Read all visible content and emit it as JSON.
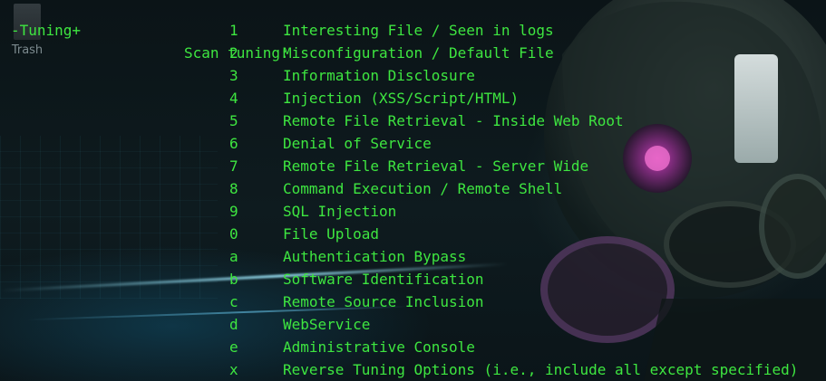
{
  "desktop": {
    "trash_label": "Trash"
  },
  "terminal": {
    "option_name": "-Tuning+",
    "option_description": "Scan tuning:",
    "tuning_options": [
      {
        "key": "1",
        "description": "Interesting File / Seen in logs"
      },
      {
        "key": "2",
        "description": "Misconfiguration / Default File"
      },
      {
        "key": "3",
        "description": "Information Disclosure"
      },
      {
        "key": "4",
        "description": "Injection (XSS/Script/HTML)"
      },
      {
        "key": "5",
        "description": "Remote File Retrieval - Inside Web Root"
      },
      {
        "key": "6",
        "description": "Denial of Service"
      },
      {
        "key": "7",
        "description": "Remote File Retrieval - Server Wide"
      },
      {
        "key": "8",
        "description": "Command Execution / Remote Shell"
      },
      {
        "key": "9",
        "description": "SQL Injection"
      },
      {
        "key": "0",
        "description": "File Upload"
      },
      {
        "key": "a",
        "description": "Authentication Bypass"
      },
      {
        "key": "b",
        "description": "Software Identification"
      },
      {
        "key": "c",
        "description": "Remote Source Inclusion"
      },
      {
        "key": "d",
        "description": "WebService"
      },
      {
        "key": "e",
        "description": "Administrative Console"
      },
      {
        "key": "x",
        "description": "Reverse Tuning Options (i.e., include all except specified)"
      }
    ]
  },
  "colors": {
    "terminal_text": "#3ee640",
    "background": "#0a1216",
    "trash_label": "#7c8a8e"
  }
}
